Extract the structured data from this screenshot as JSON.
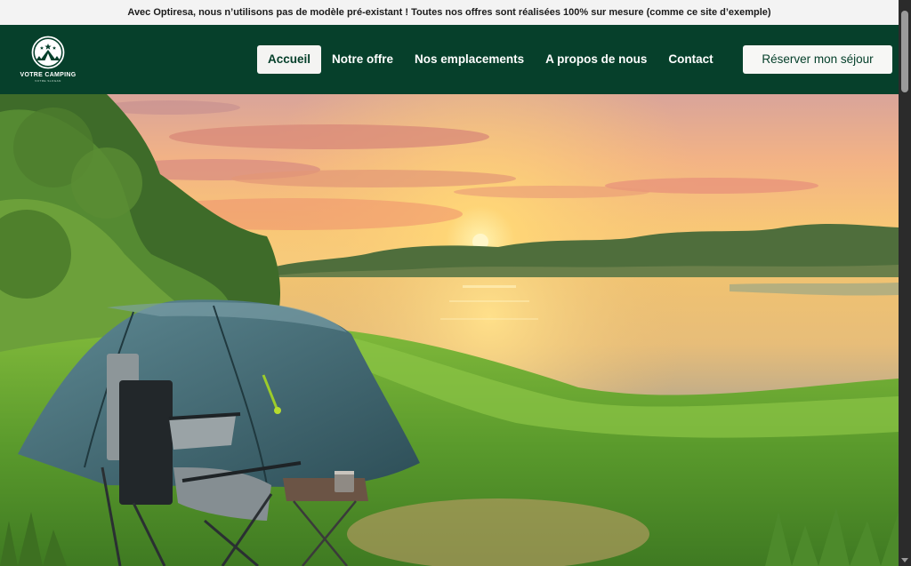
{
  "announcement": {
    "text": "Avec Optiresa, nous n’utilisons pas de modèle pré-existant ! Toutes nos offres sont réalisées 100% sur mesure (comme ce site d’exemple)"
  },
  "logo": {
    "title": "VOTRE CAMPING",
    "subtitle": "VOTRE SLOGAN",
    "icon": "tent-stars-icon"
  },
  "nav": {
    "items": [
      {
        "label": "Accueil",
        "active": true
      },
      {
        "label": "Notre offre",
        "active": false
      },
      {
        "label": "Nos emplacements",
        "active": false
      },
      {
        "label": "A propos de nous",
        "active": false
      },
      {
        "label": "Contact",
        "active": false
      }
    ]
  },
  "cta": {
    "label": "Réserver mon séjour"
  },
  "colors": {
    "header_bg": "#06402b",
    "topbar_bg": "#f3f3f3",
    "button_bg": "#f7f7f5"
  }
}
